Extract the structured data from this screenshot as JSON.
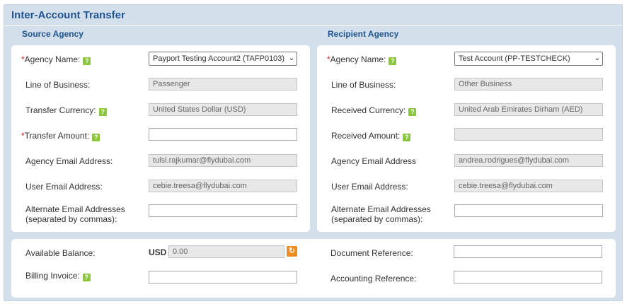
{
  "title": "Inter-Account Transfer",
  "source": {
    "heading": "Source Agency",
    "agency_name_label": "Agency Name:",
    "agency_name_value": "Payport Testing Account2 (TAFP0103)",
    "lob_label": "Line of Business:",
    "lob_value": "Passenger",
    "currency_label": "Transfer Currency:",
    "currency_value": "United States Dollar (USD)",
    "amount_label": "Transfer Amount:",
    "amount_value": "",
    "agency_email_label": "Agency Email Address:",
    "agency_email_value": "tulsi.rajkumar@flydubai.com",
    "user_email_label": "User Email Address:",
    "user_email_value": "cebie.treesa@flydubai.com",
    "alt_email_label_1": "Alternate Email Addresses",
    "alt_email_label_2": "(separated by commas):",
    "alt_email_value": ""
  },
  "recipient": {
    "heading": "Recipient Agency",
    "agency_name_label": "Agency Name:",
    "agency_name_value": "Test Account (PP-TESTCHECK)",
    "lob_label": "Line of Business:",
    "lob_value": "Other Business",
    "currency_label": "Received Currency:",
    "currency_value": "United Arab Emirates Dirham (AED)",
    "amount_label": "Received Amount:",
    "amount_value": "",
    "agency_email_label": "Agency Email Address",
    "agency_email_value": "andrea.rodrigues@flydubai.com",
    "user_email_label": "User Email Address:",
    "user_email_value": "cebie.treesa@flydubai.com",
    "alt_email_label_1": "Alternate Email Addresses",
    "alt_email_label_2": "(separated by commas):",
    "alt_email_value": ""
  },
  "bottom": {
    "balance_label": "Available Balance:",
    "balance_currency": "USD",
    "balance_value": "0.00",
    "invoice_label": "Billing Invoice:",
    "invoice_value": "",
    "doc_ref_label": "Document Reference:",
    "doc_ref_value": "",
    "acct_ref_label": "Accounting Reference:",
    "acct_ref_value": ""
  },
  "symbols": {
    "required": "*",
    "help": "?",
    "chevron": "⌄",
    "refresh": "↻"
  },
  "icons": {
    "help": "help-icon",
    "refresh": "refresh-icon",
    "chevron": "chevron-down-icon"
  },
  "colors": {
    "accent": "#1f5391",
    "help_icon": "#8cc63f",
    "refresh_icon": "#f08c1e",
    "required": "#cc2222",
    "frame": "#d3e0ec"
  }
}
